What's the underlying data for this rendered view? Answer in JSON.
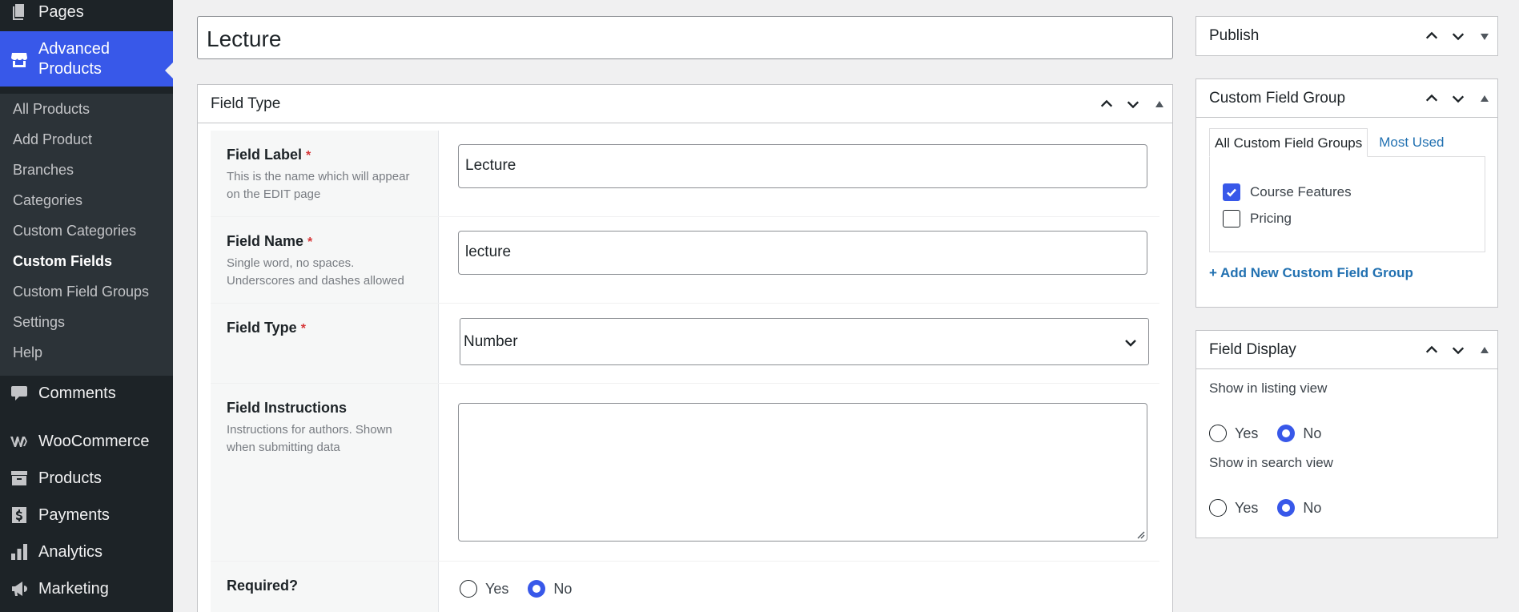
{
  "sidebar": {
    "top_items": [
      {
        "label": "Pages",
        "icon": "pages-icon"
      },
      {
        "label": "Advanced\nProducts",
        "icon": "store-icon",
        "current": true
      }
    ],
    "submenu": [
      {
        "label": "All Products"
      },
      {
        "label": "Add Product"
      },
      {
        "label": "Branches"
      },
      {
        "label": "Categories"
      },
      {
        "label": "Custom Categories"
      },
      {
        "label": "Custom Fields",
        "current": true
      },
      {
        "label": "Custom Field Groups"
      },
      {
        "label": "Settings"
      },
      {
        "label": "Help"
      }
    ],
    "bottom_items": [
      {
        "label": "Comments",
        "icon": "comment-icon"
      },
      {
        "label": "WooCommerce",
        "icon": "woocommerce-icon"
      },
      {
        "label": "Products",
        "icon": "archive-icon"
      },
      {
        "label": "Payments",
        "icon": "dollar-icon"
      },
      {
        "label": "Analytics",
        "icon": "bar-chart-icon"
      },
      {
        "label": "Marketing",
        "icon": "megaphone-icon"
      }
    ]
  },
  "title": "Lecture",
  "field_type_box": {
    "heading": "Field Type",
    "rows": [
      {
        "label": "Field Label",
        "required": "*",
        "description": "This is the name which will appear on the EDIT page",
        "value": "Lecture"
      },
      {
        "label": "Field Name",
        "required": "*",
        "description": "Single word, no spaces. Underscores and dashes allowed",
        "value": "lecture"
      },
      {
        "label": "Field Type",
        "required": "*",
        "value": "Number"
      },
      {
        "label": "Field Instructions",
        "description": "Instructions for authors. Shown when submitting data",
        "value": ""
      },
      {
        "label": "Required?",
        "options": [
          "Yes",
          "No"
        ],
        "selected": "No"
      }
    ]
  },
  "publish_box": {
    "heading": "Publish"
  },
  "custom_field_group_box": {
    "heading": "Custom Field Group",
    "tabs": [
      "All Custom Field Groups",
      "Most Used"
    ],
    "active_tab": "All Custom Field Groups",
    "groups": [
      {
        "label": "Course Features",
        "checked": true
      },
      {
        "label": "Pricing",
        "checked": false
      }
    ],
    "add_link": "+ Add New Custom Field Group"
  },
  "field_display_box": {
    "heading": "Field Display",
    "listing_label": "Show in listing view",
    "listing_options": [
      "Yes",
      "No"
    ],
    "listing_selected": "No",
    "search_label": "Show in search view",
    "search_options": [
      "Yes",
      "No"
    ],
    "search_selected": "No"
  },
  "colors": {
    "accent": "#3858e9",
    "sidebar_bg": "#1d2327",
    "submenu_bg": "#2c3338",
    "link": "#2271b1",
    "required": "#d63638"
  }
}
